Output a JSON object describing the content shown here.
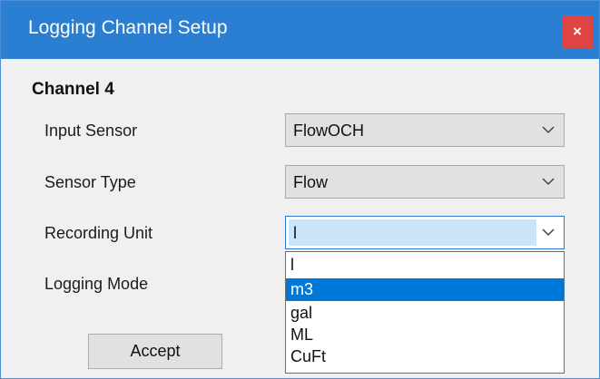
{
  "window": {
    "title": "Logging Channel Setup",
    "close_glyph": "×",
    "accent_color": "#2a7fd2",
    "close_color": "#e04343"
  },
  "section": {
    "title": "Channel 4"
  },
  "fields": {
    "input_sensor": {
      "label": "Input Sensor",
      "value": "FlowOCH"
    },
    "sensor_type": {
      "label": "Sensor Type",
      "value": "Flow"
    },
    "recording_unit": {
      "label": "Recording Unit",
      "value": "l"
    },
    "logging_mode": {
      "label": "Logging Mode"
    }
  },
  "dropdown": {
    "options": [
      "l",
      "m3",
      "gal",
      "ML",
      "CuFt"
    ],
    "highlighted": "m3",
    "highlight_color": "#0078d7"
  },
  "buttons": {
    "accept": "Accept"
  },
  "icons": {
    "close": "close-icon",
    "chevron": "chevron-down-icon"
  }
}
